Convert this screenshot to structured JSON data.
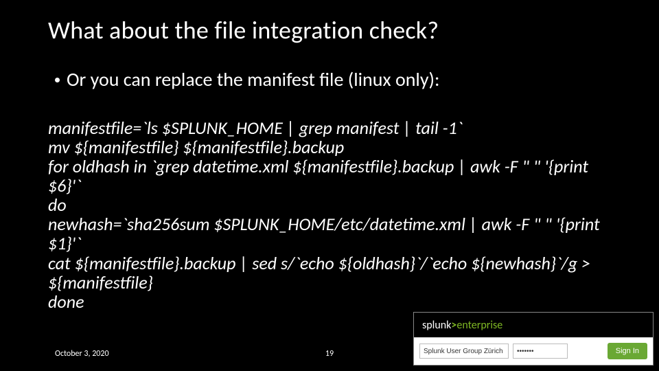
{
  "title": "What about the file integration check?",
  "bullet": "Or you can replace the manifest file (linux only):",
  "code": {
    "l1": "manifestfile=`ls $SPLUNK_HOME | grep manifest | tail -1`",
    "l2": "mv ${manifestfile} ${manifestfile}.backup",
    "l3": "for oldhash in `grep datetime.xml ${manifestfile}.backup | awk -F \" \" '{print $6}'`",
    "l4": "do",
    "l5": "newhash=`sha256sum $SPLUNK_HOME/etc/datetime.xml | awk -F \" \" '{print $1}'`",
    "l6": "cat ${manifestfile}.backup | sed s/`echo ${oldhash}`/`echo ${newhash}`/g > ${manifestfile}",
    "l7": "done"
  },
  "footer": {
    "date": "October 3, 2020",
    "page": "19"
  },
  "login": {
    "brand_a": "splunk",
    "brand_b": ">",
    "brand_c": "enterprise",
    "user_value": "Splunk User Group Zürich",
    "pass_value": "•••••••",
    "signin": "Sign In"
  }
}
